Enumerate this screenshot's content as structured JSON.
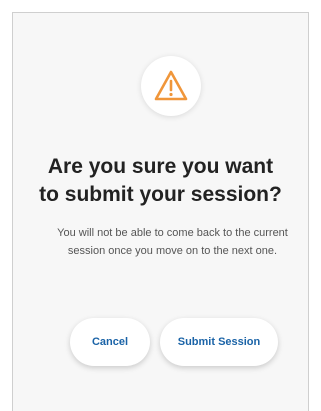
{
  "dialog": {
    "icon": "warning-triangle-icon",
    "accent_color": "#f0963a",
    "title_line1": "Are you sure you want",
    "title_line2": "to submit your session?",
    "message": "You will not be able to come back to the current session once you move on to the next one.",
    "cancel_label": "Cancel",
    "submit_label": "Submit Session",
    "button_text_color": "#1a63a7"
  }
}
